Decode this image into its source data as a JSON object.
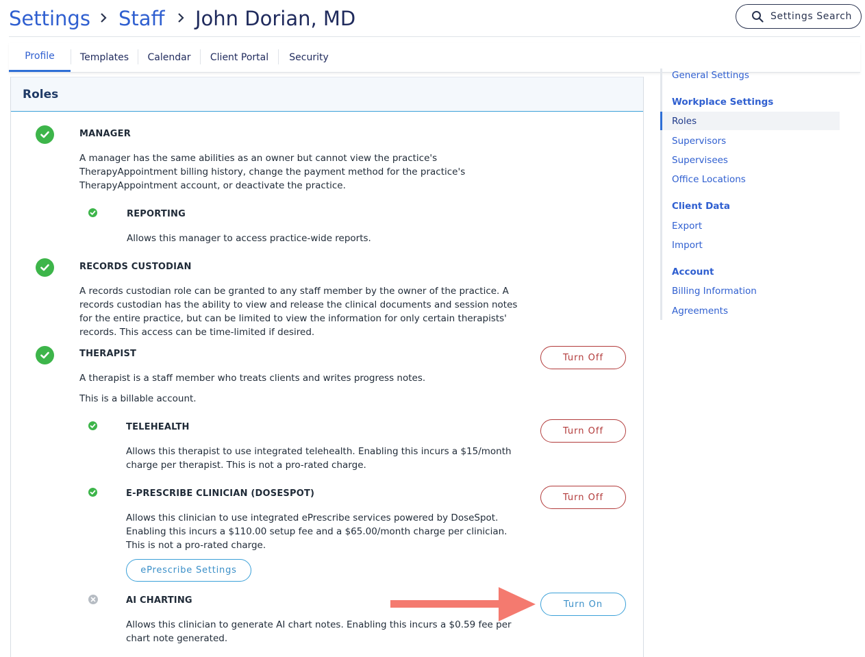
{
  "breadcrumb": {
    "settings": "Settings",
    "staff": "Staff",
    "current": "John Dorian, MD"
  },
  "search": {
    "label": "Settings Search"
  },
  "tabs": [
    {
      "label": "Profile",
      "active": true
    },
    {
      "label": "Templates"
    },
    {
      "label": "Calendar"
    },
    {
      "label": "Client Portal"
    },
    {
      "label": "Security"
    }
  ],
  "panel": {
    "title": "Roles"
  },
  "roles": {
    "manager": {
      "title": "MANAGER",
      "description": "A manager has the same abilities as an owner but cannot view the practice's TherapyAppointment billing history, change the payment method for the practice's TherapyAppointment account, or deactivate the practice.",
      "enabled": true
    },
    "reporting": {
      "title": "REPORTING",
      "description": "Allows this manager to access practice-wide reports.",
      "enabled": true
    },
    "records": {
      "title": "RECORDS CUSTODIAN",
      "description": "A records custodian role can be granted to any staff member by the owner of the practice. A records custodian has the ability to view and release the clinical documents and session notes for the entire practice, but can be limited to view the information for only certain therapists' records. This access can be time-limited if desired.",
      "enabled": true
    },
    "therapist": {
      "title": "THERAPIST",
      "description": "A therapist is a staff member who treats clients and writes progress notes.",
      "note": "This is a billable account.",
      "button": "Turn Off",
      "enabled": true
    },
    "telehealth": {
      "title": "TELEHEALTH",
      "description": "Allows this therapist to use integrated telehealth. Enabling this incurs a $15/month charge per therapist. This is not a pro-rated charge.",
      "button": "Turn Off",
      "enabled": true
    },
    "eprescribe": {
      "title": "E-PRESCRIBE CLINICIAN (DOSESPOT)",
      "description": "Allows this clinician to use integrated ePrescribe services powered by DoseSpot. Enabling this incurs a $110.00 setup fee and a $65.00/month charge per clinician. This is not a pro-rated charge.",
      "button": "Turn Off",
      "settings_button": "ePrescribe Settings",
      "enabled": true
    },
    "ai": {
      "title": "AI CHARTING",
      "description": "Allows this clinician to generate AI chart notes. Enabling this incurs a $0.59 fee per chart note generated.",
      "button": "Turn On",
      "enabled": false
    }
  },
  "sidebar": {
    "general": "General Settings",
    "workplace": "Workplace Settings",
    "roles": "Roles",
    "supervisors": "Supervisors",
    "supervisees": "Supervisees",
    "office_locations": "Office Locations",
    "client_data": "Client Data",
    "export": "Export",
    "import": "Import",
    "account": "Account",
    "billing": "Billing Information",
    "agreements": "Agreements"
  },
  "colors": {
    "accent": "#2f5fd0",
    "success": "#3db54a",
    "danger": "#b23a3a",
    "info": "#3aa0d8",
    "arrow": "#f47a6f"
  }
}
